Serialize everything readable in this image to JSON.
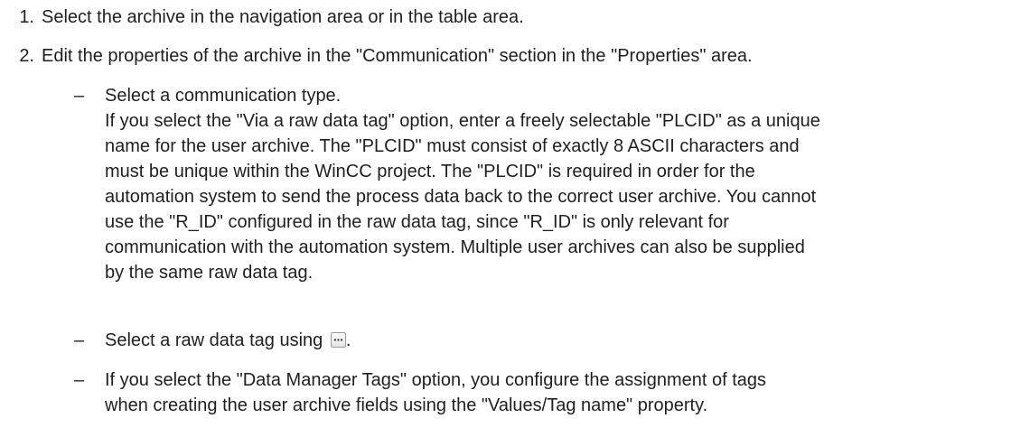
{
  "steps": [
    {
      "number": "1.",
      "text": "Select the archive in the navigation area or in the table area."
    },
    {
      "number": "2.",
      "text": "Edit the properties of the archive in the \"Communication\" section in the \"Properties\" area."
    }
  ],
  "subitems": {
    "dash": "–",
    "item1_title": "Select a communication type.",
    "item1_lines": [
      "If you select the \"Via a raw data tag\" option, enter a freely selectable \"PLCID\" as a unique",
      "name for the user archive. The \"PLCID\" must consist of exactly 8 ASCII characters and",
      "must be unique within the WinCC project. The \"PLCID\" is required in order for the",
      "automation system to send the process data back to the correct user archive. You cannot",
      "use the \"R_ID\" configured in the raw data tag, since \"R_ID\" is only relevant for",
      "communication with the automation system. Multiple user archives can also be supplied",
      "by the same raw data tag."
    ],
    "item2_text": "Select a raw data tag using",
    "item2_suffix": ".",
    "item3_lines": [
      "If you select the \"Data Manager Tags\" option, you configure the assignment of tags",
      "when creating the user archive fields using the \"Values/Tag name\" property."
    ]
  },
  "icons": {
    "browse_button": "ellipsis-button-icon"
  }
}
